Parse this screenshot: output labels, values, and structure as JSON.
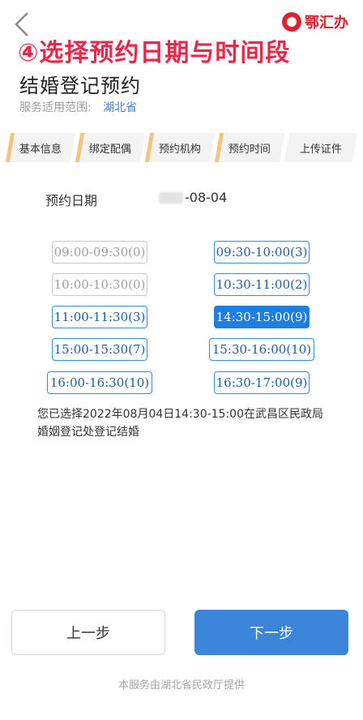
{
  "brand": {
    "name": "鄂汇办",
    "logo_icon": "ehuiban-logo-icon"
  },
  "step_banner": "④选择预约日期与时间段",
  "page": {
    "title": "结婚登记预约",
    "scope_label": "服务适用范围:",
    "scope_value": "湖北省"
  },
  "steps": [
    {
      "label": "基本信息"
    },
    {
      "label": "绑定配偶"
    },
    {
      "label": "预约机构"
    },
    {
      "label": "预约时间"
    },
    {
      "label": "上传证件"
    }
  ],
  "date": {
    "label": "预约日期",
    "value_visible": "-08-04"
  },
  "slots": [
    {
      "label": "09:00-09:30(0)"
    },
    {
      "label": "09:30-10:00(3)"
    },
    {
      "label": "10:00-10:30(0)"
    },
    {
      "label": "10:30-11:00(2)"
    },
    {
      "label": "11:00-11:30(3)"
    },
    {
      "label": "14:30-15:00(9)"
    },
    {
      "label": "15:00-15:30(7)"
    },
    {
      "label": "15:30-16:00(10)"
    },
    {
      "label": "16:00-16:30(10)"
    },
    {
      "label": "16:30-17:00(9)"
    }
  ],
  "confirm_text": "您已选择2022年08月04日14:30-15:00在武昌区民政局婚姻登记处登记结婚",
  "buttons": {
    "prev": "上一步",
    "next": "下一步"
  },
  "footer": "本服务由湖北省民政厅提供",
  "colors": {
    "accent": "#3a84da",
    "slot_border": "#2c8ee6",
    "banner": "#e6284a",
    "step_tab_mark": "#f2c57a"
  }
}
